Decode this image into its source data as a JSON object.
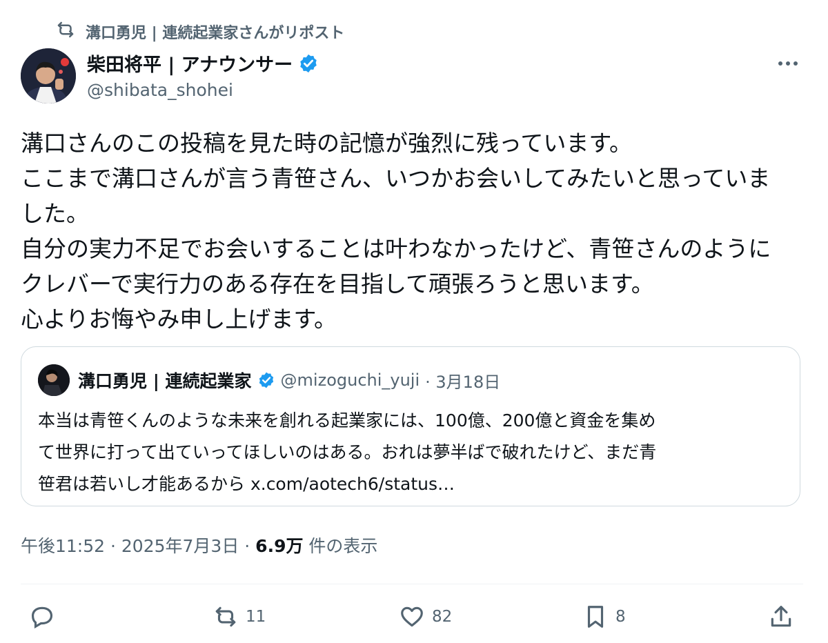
{
  "repost": {
    "label": "溝口勇児 | 連続起業家さんがリポスト",
    "icon": "repost-icon"
  },
  "author": {
    "name": "柴田将平 | アナウンサー",
    "handle": "@shibata_shohei",
    "verified_icon": "verified-badge-icon"
  },
  "post": {
    "text": "溝口さんのこの投稿を見た時の記憶が強烈に残っています。\nここまで溝口さんが言う青笹さん、いつかお会いしてみたいと思っていま\nした。\n自分の実力不足でお会いすることは叶わなかったけど、青笹さんのように\nクレバーで実行力のある存在を目指して頑張ろうと思います。\n心よりお悔やみ申し上げます。",
    "time": "午後11:52 · 2025年7月3日 · ",
    "views": "6.9万",
    "views_label": " 件の表示"
  },
  "quote": {
    "name": "溝口勇児 | 連続起業家",
    "handle": "@mizoguchi_yuji",
    "date": "· 3月18日",
    "text": "本当は青笹くんのような未来を創れる起業家には、100億、200億と資金を集め\nて世界に打って出ていってほしいのはある。おれは夢半ばで破れたけど、まだ青\n笹君は若いし才能あるから x.com/aotech6/status…"
  },
  "actions": {
    "reply": {
      "icon": "reply-icon",
      "count": ""
    },
    "repost": {
      "icon": "repost-icon",
      "count": "11"
    },
    "like": {
      "icon": "heart-icon",
      "count": "82"
    },
    "bookmark": {
      "icon": "bookmark-icon",
      "count": "8"
    },
    "share": {
      "icon": "share-icon",
      "count": ""
    }
  },
  "colors": {
    "text": "#0f1419",
    "muted": "#536471",
    "verified": "#1d9bf0",
    "border": "#cfd9de"
  }
}
